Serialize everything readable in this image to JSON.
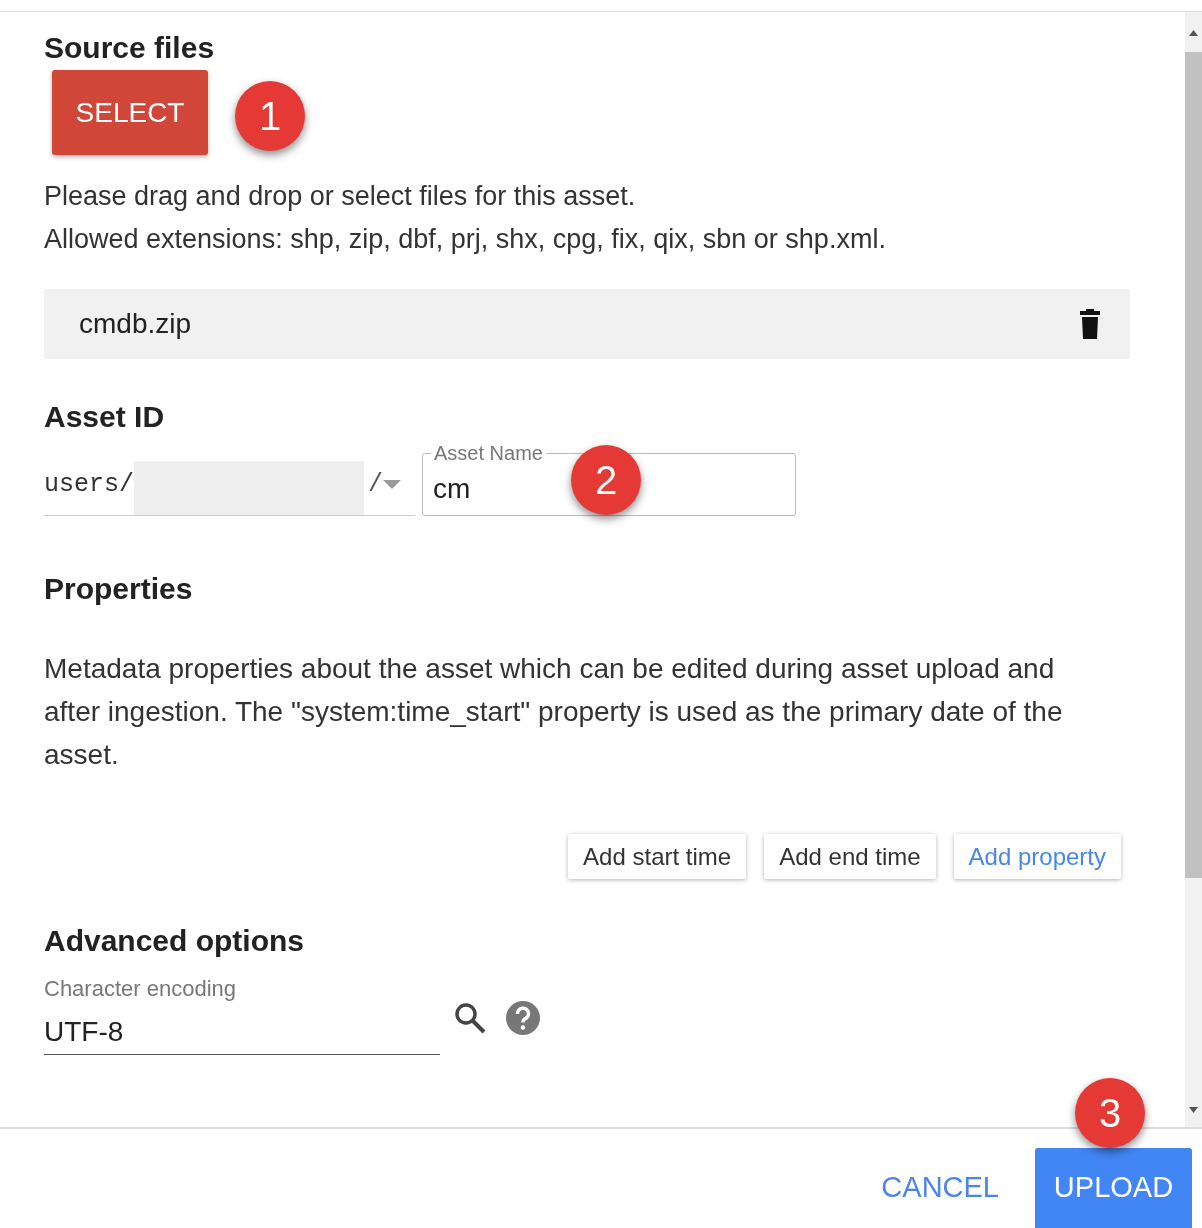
{
  "source_files": {
    "heading": "Source files",
    "select_button": "SELECT",
    "badge": "1",
    "instructions": [
      "Please drag and drop or select files for this asset.",
      "Allowed extensions: shp, zip, dbf, prj, shx, cpg, fix, qix, sbn or shp.xml."
    ],
    "files": [
      {
        "name": "cmdb.zip"
      }
    ]
  },
  "asset_id": {
    "heading": "Asset ID",
    "path_prefix": "users/",
    "path_separator": "/",
    "name_field": {
      "label": "Asset Name",
      "value": "cm"
    },
    "badge": "2"
  },
  "properties": {
    "heading": "Properties",
    "description": "Metadata properties about the asset which can be edited during asset upload and after ingestion. The \"system:time_start\" property is used as the primary date of the asset.",
    "buttons": [
      {
        "label": "Add start time",
        "kind": "plain"
      },
      {
        "label": "Add end time",
        "kind": "plain"
      },
      {
        "label": "Add property",
        "kind": "link"
      }
    ]
  },
  "advanced": {
    "heading": "Advanced options",
    "encoding": {
      "label": "Character encoding",
      "value": "UTF-8"
    }
  },
  "footer": {
    "cancel": "CANCEL",
    "upload": "UPLOAD",
    "badge": "3"
  }
}
